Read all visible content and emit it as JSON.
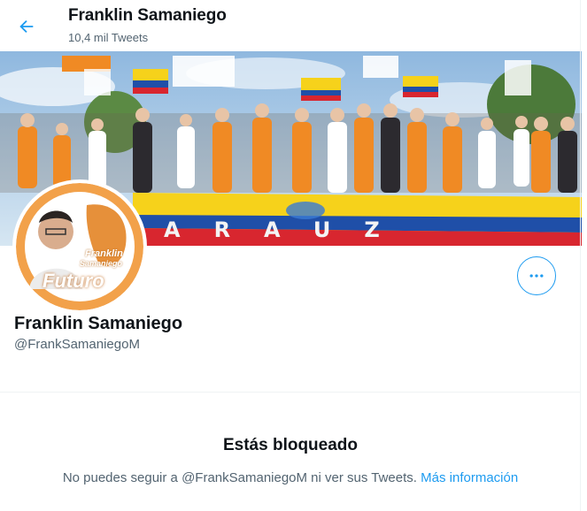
{
  "header": {
    "back_icon": "arrow-left-icon",
    "title": "Franklin Samaniego",
    "tweet_count": "10,4 mil Tweets"
  },
  "banner": {
    "flag_text": "ARAUZ"
  },
  "avatar": {
    "line1": "Franklin",
    "line2": "Samaniego",
    "line3": "Futuro"
  },
  "actions": {
    "more_icon": "more-horizontal-icon"
  },
  "profile": {
    "name": "Franklin Samaniego",
    "handle": "@FrankSamaniegoM"
  },
  "blocked": {
    "title": "Estás bloqueado",
    "message": "No puedes seguir a @FrankSamaniegoM ni ver sus Tweets.",
    "link": "Más información"
  },
  "colors": {
    "accent": "#1d9bf0",
    "secondary_text": "#536471",
    "banner_orange": "#f08a24"
  }
}
